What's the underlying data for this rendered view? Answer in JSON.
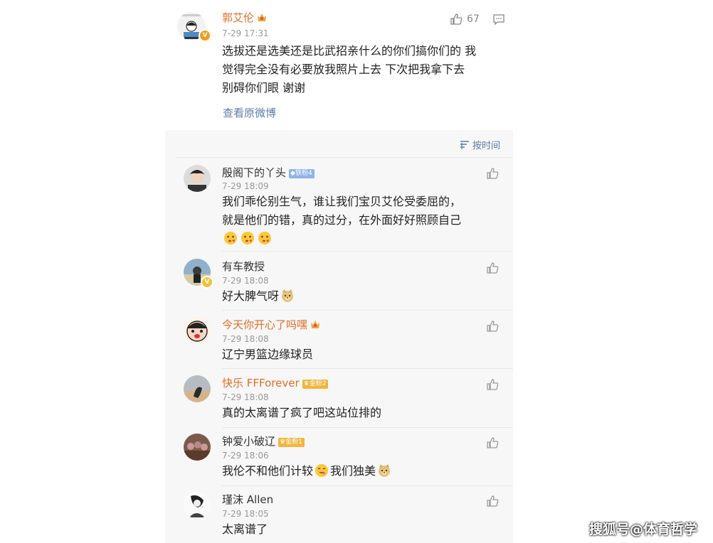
{
  "post": {
    "author": "郭艾伦",
    "time": "7-29 17:31",
    "like_count": "67",
    "text_lines": [
      "选拔还是选美还是比武招亲什么的你们搞你们的 我",
      "觉得完全没有必要放我照片上去 下次把我拿下去",
      "别碍你们眼 谢谢"
    ],
    "view_original": "查看原微博"
  },
  "sort_label": "按时间",
  "comments": [
    {
      "name": "殷阁下的丫头",
      "badge": "铁粉4",
      "time": "7-29 18:09",
      "lines": [
        "我们乖伦别生气，谁让我们宝贝艾伦受委屈的，",
        "就是他们的错，真的过分，在外面好好照顾自己"
      ]
    },
    {
      "name": "有车教授",
      "time": "7-29 18:08",
      "lines": [
        "好大脾气呀"
      ]
    },
    {
      "name": "今天你开心了吗嘿",
      "time": "7-29 18:08",
      "lines": [
        "辽宁男篮边缘球员"
      ]
    },
    {
      "name": "快乐 FFForever",
      "badge": "金粉2",
      "time": "7-29 18:08",
      "lines": [
        "真的太离谱了疯了吧这站位排的"
      ]
    },
    {
      "name": "钟爱小破辽",
      "badge": "金粉1",
      "time": "7-29 18:06",
      "lines": [
        "我伦不和他们计较",
        "我们独美"
      ]
    },
    {
      "name": "瑾沫 Allen",
      "time": "7-29 18:05",
      "lines": [
        "太离谱了"
      ]
    }
  ],
  "watermark": "搜狐号@体育哲学",
  "colors": {
    "orange_name": "#e46c24",
    "link": "#5b7da9",
    "comment_bg": "#f7f7f7"
  }
}
